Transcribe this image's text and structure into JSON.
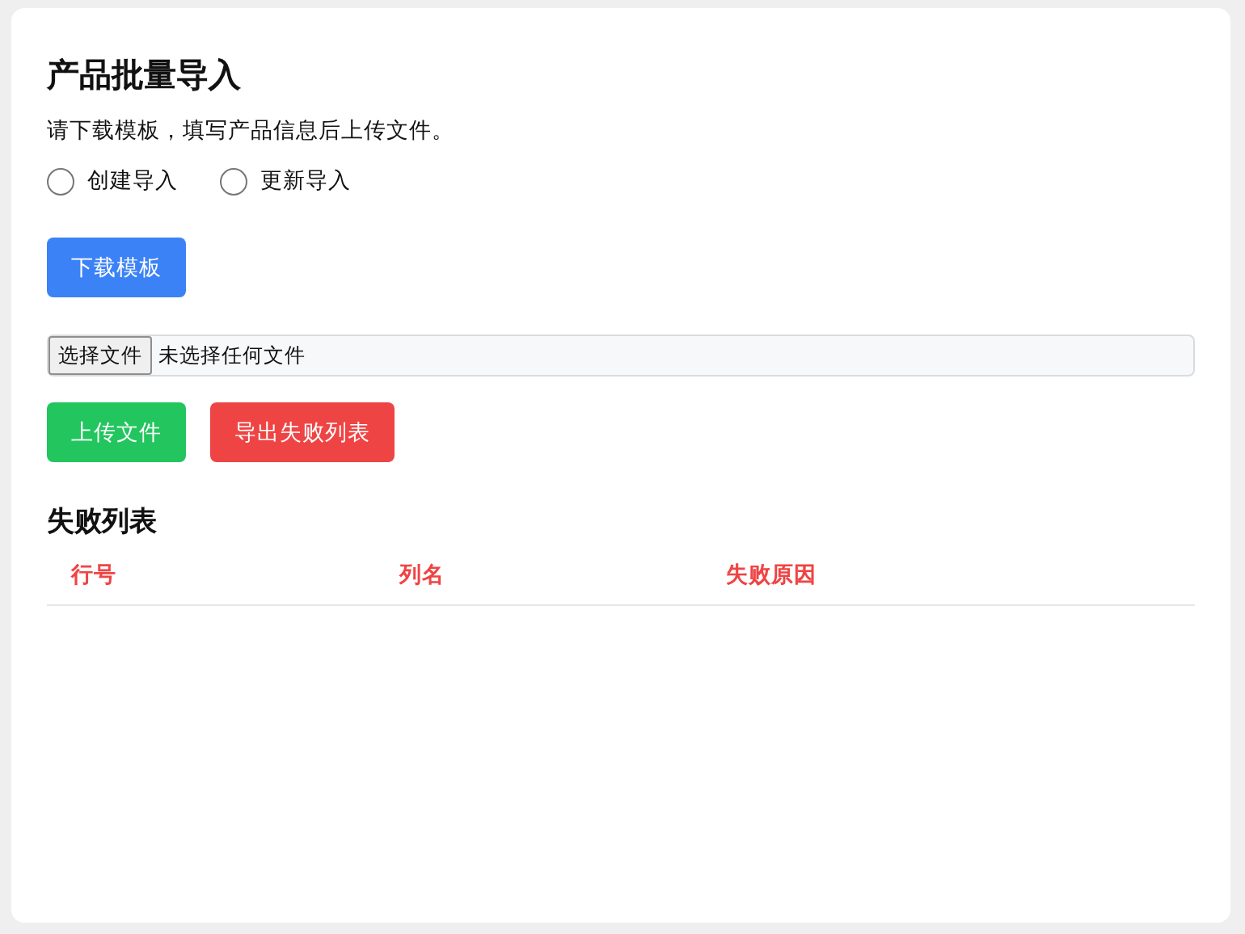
{
  "title": "产品批量导入",
  "description": "请下载模板，填写产品信息后上传文件。",
  "import_modes": [
    {
      "label": "创建导入",
      "selected": false
    },
    {
      "label": "更新导入",
      "selected": false
    }
  ],
  "download_button": {
    "label": "下载模板",
    "kind": "primary"
  },
  "file_input": {
    "button_label": "选择文件",
    "status": "未选择任何文件"
  },
  "action_buttons": [
    {
      "label": "上传文件",
      "kind": "success"
    },
    {
      "label": "导出失败列表",
      "kind": "danger"
    }
  ],
  "failure_list": {
    "title": "失败列表",
    "columns": [
      "行号",
      "列名",
      "失败原因"
    ]
  }
}
